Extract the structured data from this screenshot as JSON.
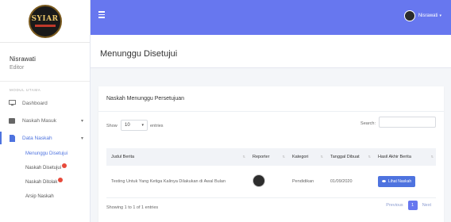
{
  "logo": {
    "text": "SYIAR"
  },
  "user": {
    "name": "Nisrawati",
    "role": "Editor"
  },
  "sidebar": {
    "section_label": "MODUL UTAMA",
    "items": [
      {
        "label": "Dashboard",
        "icon": "monitor-icon"
      },
      {
        "label": "Naskah Masuk",
        "icon": "inbox-icon"
      },
      {
        "label": "Data Naskah",
        "icon": "file-icon"
      }
    ],
    "sub_items": [
      {
        "label": "Menunggu Disetujui"
      },
      {
        "label": "Naskah Disetujui"
      },
      {
        "label": "Naskah Ditolak"
      },
      {
        "label": "Arsip Naskah"
      }
    ]
  },
  "topbar": {
    "user_label": "Nisrawati"
  },
  "page": {
    "title": "Menunggu Disetujui"
  },
  "card": {
    "title": "Naskah Menunggu Persetujuan",
    "show_label": "Show",
    "entries_value": "10",
    "entries_label": "entries",
    "search_label": "Search:",
    "columns": [
      "Judul Berita",
      "Reporter",
      "Kategori",
      "Tanggal Dibuat",
      "Hasil Akhir Berita"
    ],
    "rows": [
      {
        "judul": "Testing Untuk Yang Ketiga Kalinya Dilakukan di Awal Bulan",
        "kategori": "Pendidikan",
        "tanggal": "01/09/2020",
        "button": "Lihat Naskah"
      }
    ],
    "info": "Showing 1 to 1 of 1 entries",
    "pager": {
      "prev": "Previous",
      "page": "1",
      "next": "Next"
    }
  },
  "colors": {
    "primary": "#6777ef",
    "badge": "#e74a3b"
  }
}
